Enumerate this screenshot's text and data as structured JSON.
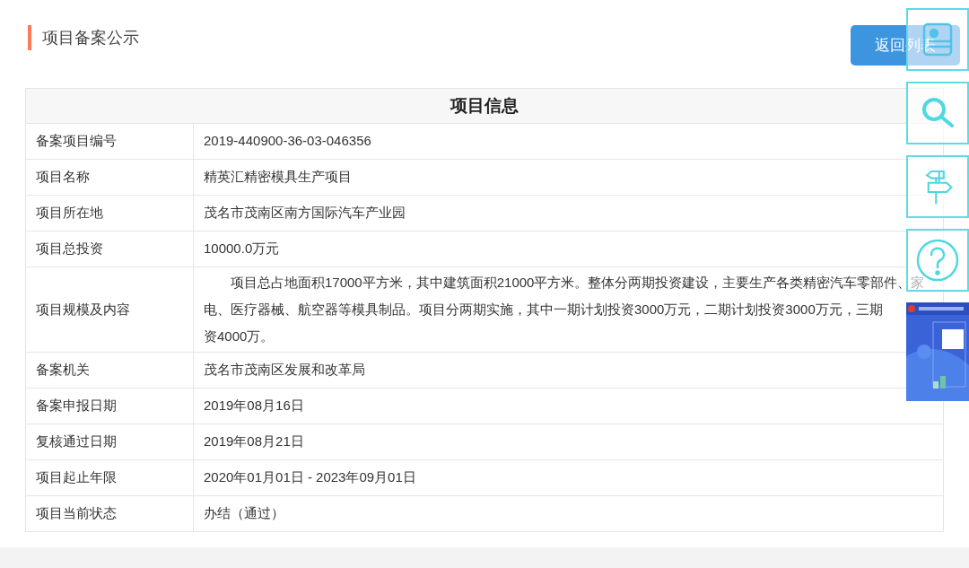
{
  "page_title": "项目备案公示",
  "back_button": "返回列表",
  "table": {
    "title": "项目信息",
    "rows": [
      {
        "label": "备案项目编号",
        "value": "2019-440900-36-03-046356"
      },
      {
        "label": "项目名称",
        "value": "精英汇精密模具生产项目"
      },
      {
        "label": "项目所在地",
        "value": "茂名市茂南区南方国际汽车产业园"
      },
      {
        "label": "项目总投资",
        "value": "10000.0万元"
      },
      {
        "label": "项目规模及内容",
        "lines": [
          "项目总占地面积17000平方米，其中建筑面积21000平方米。整体分两期投资建设，主要生产各类精密汽车零部件、家",
          "电、医疗器械、航空器等模具制品。项目分两期实施，其中一期计划投资3000万元，二期计划投资3000万元，三期",
          "资4000万。"
        ]
      },
      {
        "label": "备案机关",
        "value": "茂名市茂南区发展和改革局"
      },
      {
        "label": "备案申报日期",
        "value": "2019年08月16日"
      },
      {
        "label": "复核通过日期",
        "value": "2019年08月21日"
      },
      {
        "label": "项目起止年限",
        "value": "2020年01月01日 - 2023年09月01日"
      },
      {
        "label": "项目当前状态",
        "value": "办结（通过）"
      }
    ]
  },
  "float_tools": [
    {
      "kind": "profile"
    },
    {
      "kind": "search"
    },
    {
      "kind": "guide"
    },
    {
      "kind": "help"
    },
    {
      "kind": "picture"
    }
  ]
}
